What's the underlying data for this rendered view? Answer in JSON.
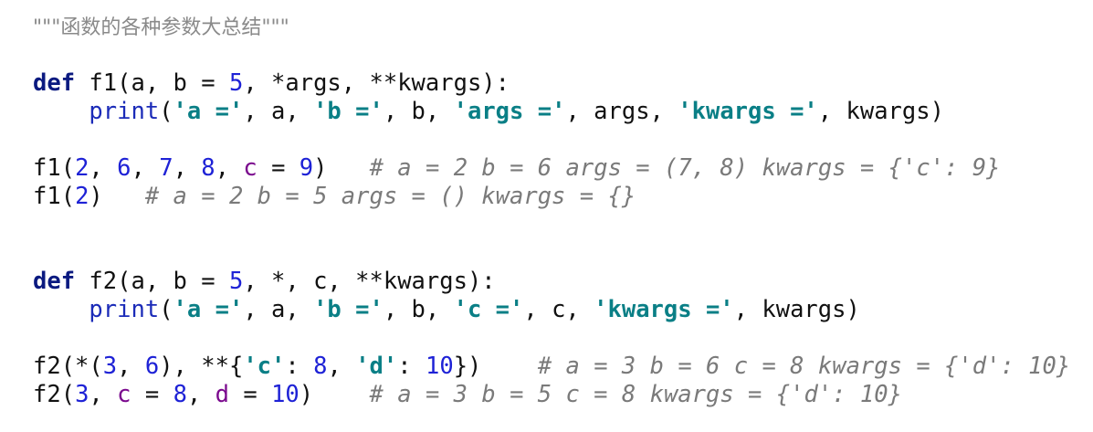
{
  "editor": {
    "lines": [
      {
        "tokens": [
          {
            "t": "\"\"\"函数的各种参数大总结\"\"\"",
            "c": "doc"
          }
        ]
      },
      {
        "tokens": []
      },
      {
        "tokens": [
          {
            "t": "def",
            "c": "kw"
          },
          {
            "t": " f1(a, b = ",
            "c": "plain"
          },
          {
            "t": "5",
            "c": "num"
          },
          {
            "t": ", *args, **kwargs):",
            "c": "plain"
          }
        ]
      },
      {
        "tokens": [
          {
            "t": "    ",
            "c": "plain"
          },
          {
            "t": "print",
            "c": "builtin"
          },
          {
            "t": "(",
            "c": "plain"
          },
          {
            "t": "'a ='",
            "c": "str"
          },
          {
            "t": ", a, ",
            "c": "plain"
          },
          {
            "t": "'b ='",
            "c": "str"
          },
          {
            "t": ", b, ",
            "c": "plain"
          },
          {
            "t": "'args ='",
            "c": "str"
          },
          {
            "t": ", args, ",
            "c": "plain"
          },
          {
            "t": "'kwargs ='",
            "c": "str"
          },
          {
            "t": ", kwargs)",
            "c": "plain"
          }
        ]
      },
      {
        "tokens": []
      },
      {
        "tokens": [
          {
            "t": "f1(",
            "c": "plain"
          },
          {
            "t": "2",
            "c": "num"
          },
          {
            "t": ", ",
            "c": "plain"
          },
          {
            "t": "6",
            "c": "num"
          },
          {
            "t": ", ",
            "c": "plain"
          },
          {
            "t": "7",
            "c": "num"
          },
          {
            "t": ", ",
            "c": "plain"
          },
          {
            "t": "8",
            "c": "num"
          },
          {
            "t": ", ",
            "c": "plain"
          },
          {
            "t": "c",
            "c": "kwarg"
          },
          {
            "t": " = ",
            "c": "plain"
          },
          {
            "t": "9",
            "c": "num"
          },
          {
            "t": ")   ",
            "c": "plain"
          },
          {
            "t": "# a = 2 b = 6 args = (7, 8) kwargs = {'c': 9}",
            "c": "comment"
          }
        ]
      },
      {
        "tokens": [
          {
            "t": "f1(",
            "c": "plain"
          },
          {
            "t": "2",
            "c": "num"
          },
          {
            "t": ")   ",
            "c": "plain"
          },
          {
            "t": "# a = 2 b = 5 args = () kwargs = {}",
            "c": "comment"
          }
        ]
      },
      {
        "tokens": []
      },
      {
        "tokens": []
      },
      {
        "tokens": [
          {
            "t": "def",
            "c": "kw"
          },
          {
            "t": " f2(a, b = ",
            "c": "plain"
          },
          {
            "t": "5",
            "c": "num"
          },
          {
            "t": ", *, c, **kwargs):",
            "c": "plain"
          }
        ]
      },
      {
        "tokens": [
          {
            "t": "    ",
            "c": "plain"
          },
          {
            "t": "print",
            "c": "builtin"
          },
          {
            "t": "(",
            "c": "plain"
          },
          {
            "t": "'a ='",
            "c": "str"
          },
          {
            "t": ", a, ",
            "c": "plain"
          },
          {
            "t": "'b ='",
            "c": "str"
          },
          {
            "t": ", b, ",
            "c": "plain"
          },
          {
            "t": "'c ='",
            "c": "str"
          },
          {
            "t": ", c, ",
            "c": "plain"
          },
          {
            "t": "'kwargs ='",
            "c": "str"
          },
          {
            "t": ", kwargs)",
            "c": "plain"
          }
        ]
      },
      {
        "tokens": []
      },
      {
        "tokens": [
          {
            "t": "f2(*(",
            "c": "plain"
          },
          {
            "t": "3",
            "c": "num"
          },
          {
            "t": ", ",
            "c": "plain"
          },
          {
            "t": "6",
            "c": "num"
          },
          {
            "t": "), **{",
            "c": "plain"
          },
          {
            "t": "'c'",
            "c": "str"
          },
          {
            "t": ": ",
            "c": "plain"
          },
          {
            "t": "8",
            "c": "num"
          },
          {
            "t": ", ",
            "c": "plain"
          },
          {
            "t": "'d'",
            "c": "str"
          },
          {
            "t": ": ",
            "c": "plain"
          },
          {
            "t": "10",
            "c": "num"
          },
          {
            "t": "})    ",
            "c": "plain"
          },
          {
            "t": "# a = 3 b = 6 c = 8 kwargs = {'d': 10}",
            "c": "comment"
          }
        ]
      },
      {
        "tokens": [
          {
            "t": "f2(",
            "c": "plain"
          },
          {
            "t": "3",
            "c": "num"
          },
          {
            "t": ", ",
            "c": "plain"
          },
          {
            "t": "c",
            "c": "kwarg"
          },
          {
            "t": " = ",
            "c": "plain"
          },
          {
            "t": "8",
            "c": "num"
          },
          {
            "t": ", ",
            "c": "plain"
          },
          {
            "t": "d",
            "c": "kwarg"
          },
          {
            "t": " = ",
            "c": "plain"
          },
          {
            "t": "10",
            "c": "num"
          },
          {
            "t": ")    ",
            "c": "plain"
          },
          {
            "t": "# a = 3 b = 5 c = 8 kwargs = {'d': 10}",
            "c": "comment"
          }
        ]
      }
    ]
  }
}
